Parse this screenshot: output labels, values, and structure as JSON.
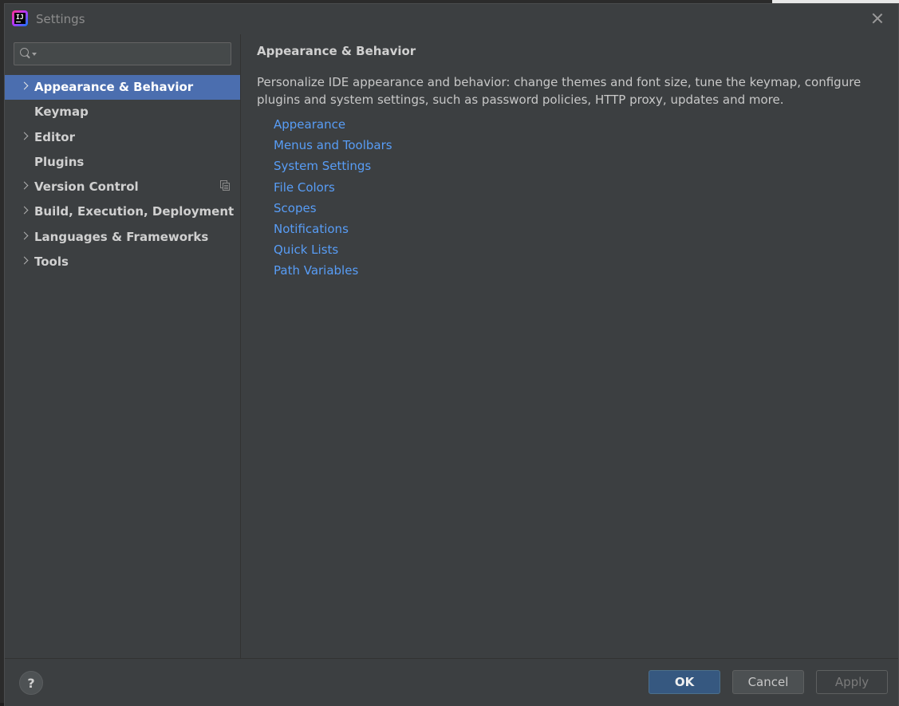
{
  "window": {
    "title": "Settings",
    "close_icon": "close-icon",
    "app_icon": "intellij-idea-icon",
    "app_icon_text": "IJ"
  },
  "sidebar": {
    "search": {
      "value": "",
      "placeholder": "",
      "icon": "search-icon"
    },
    "items": [
      {
        "label": "Appearance & Behavior",
        "expandable": true,
        "selected": true
      },
      {
        "label": "Keymap",
        "expandable": false,
        "selected": false
      },
      {
        "label": "Editor",
        "expandable": true,
        "selected": false
      },
      {
        "label": "Plugins",
        "expandable": false,
        "selected": false
      },
      {
        "label": "Version Control",
        "expandable": true,
        "selected": false,
        "icon": "project-settings-icon"
      },
      {
        "label": "Build, Execution, Deployment",
        "expandable": true,
        "selected": false
      },
      {
        "label": "Languages & Frameworks",
        "expandable": true,
        "selected": false
      },
      {
        "label": "Tools",
        "expandable": true,
        "selected": false
      }
    ]
  },
  "content": {
    "title": "Appearance & Behavior",
    "description": "Personalize IDE appearance and behavior: change themes and font size, tune the keymap, configure plugins and system settings, such as password policies, HTTP proxy, updates and more.",
    "links": [
      "Appearance",
      "Menus and Toolbars",
      "System Settings",
      "File Colors",
      "Scopes",
      "Notifications",
      "Quick Lists",
      "Path Variables"
    ]
  },
  "footer": {
    "help_label": "?",
    "ok_label": "OK",
    "cancel_label": "Cancel",
    "apply_label": "Apply",
    "apply_enabled": false
  },
  "colors": {
    "selection": "#4b6eaf",
    "link": "#589df6",
    "ok_button": "#365880",
    "background": "#3c3f41"
  }
}
